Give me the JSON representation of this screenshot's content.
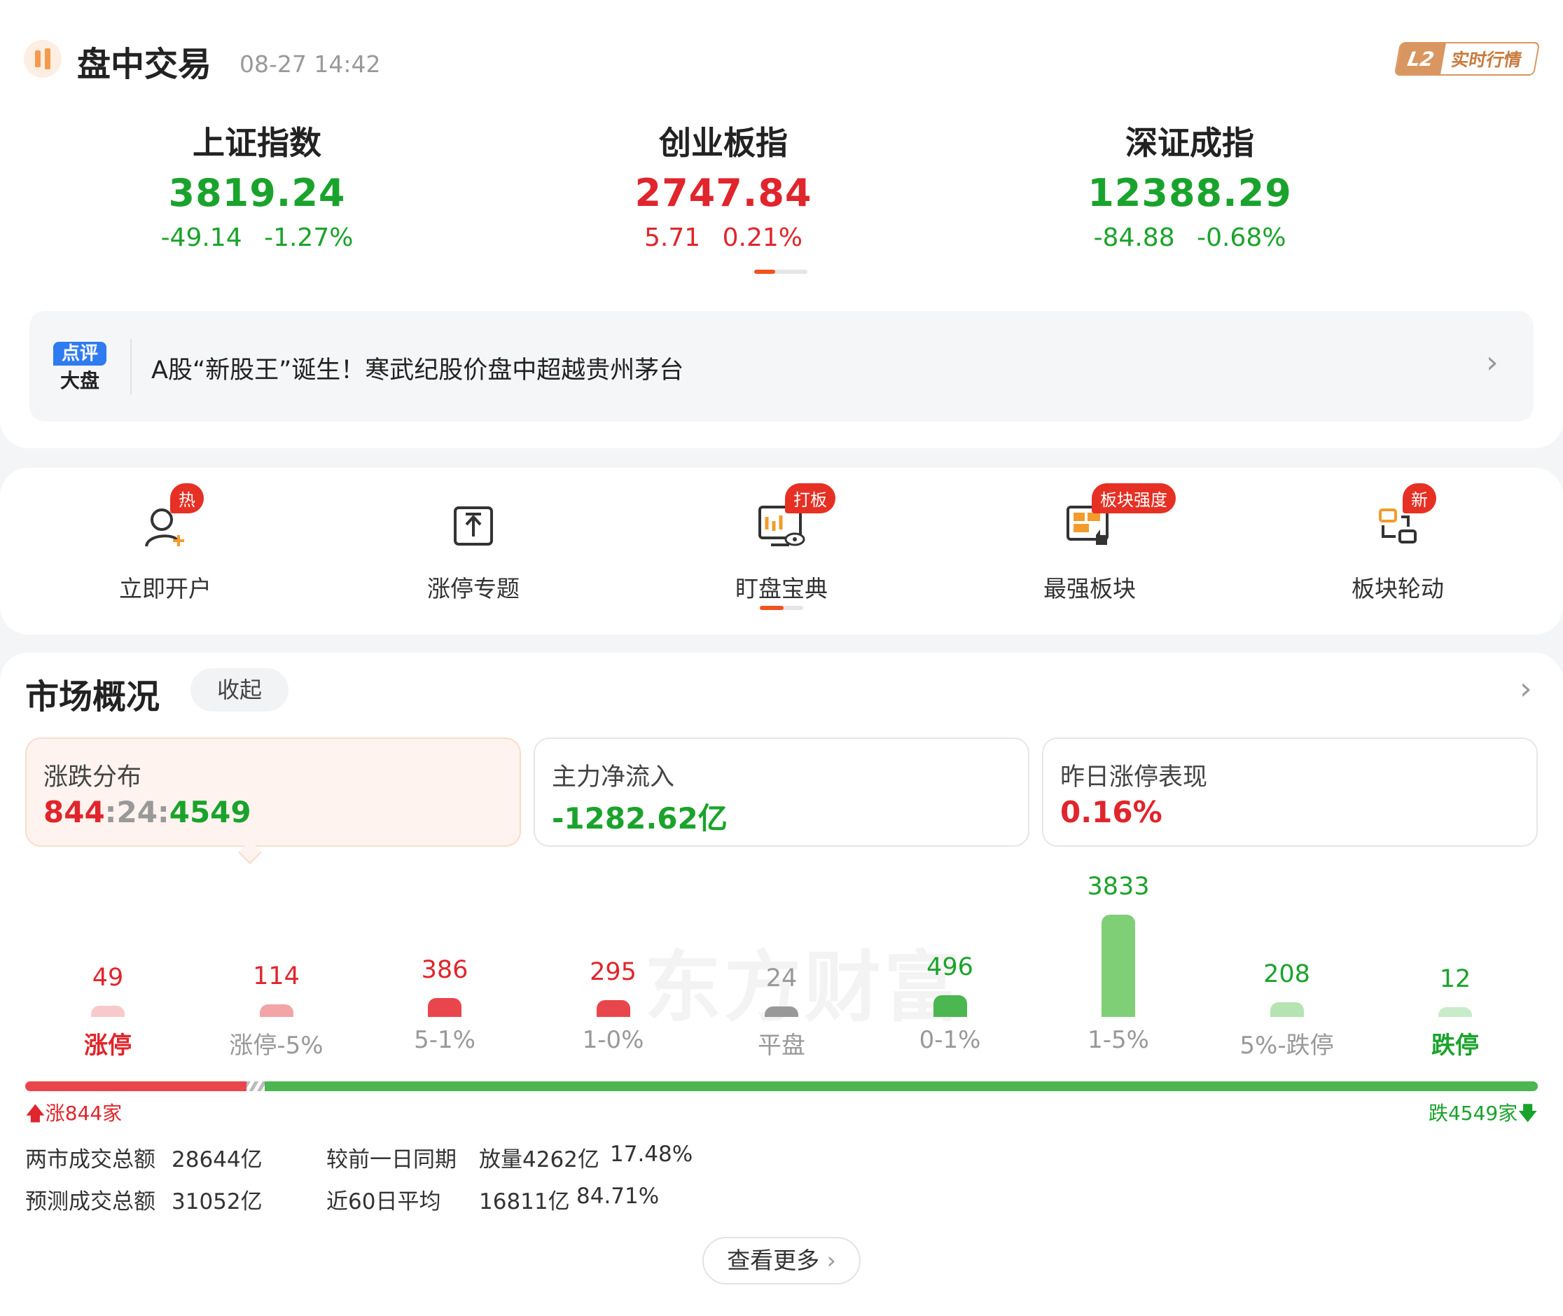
{
  "header": {
    "title": "盘中交易",
    "timestamp": "08-27 14:42",
    "badge_l2": "L2",
    "badge_text": "实时行情"
  },
  "indices": [
    {
      "name": "上证指数",
      "value": "3819.24",
      "change": "-49.14",
      "percent": "-1.27%",
      "trend": "down"
    },
    {
      "name": "创业板指",
      "value": "2747.84",
      "change": "5.71",
      "percent": "0.21%",
      "trend": "up"
    },
    {
      "name": "深证成指",
      "value": "12388.29",
      "change": "-84.88",
      "percent": "-0.68%",
      "trend": "down"
    }
  ],
  "news": {
    "icon_top": "点评",
    "icon_bottom": "大盘",
    "headline": "A股“新股王”诞生！寒武纪股价盘中超越贵州茅台"
  },
  "quick_nav": [
    {
      "label": "立即开户",
      "badge": "热",
      "icon": "user-add-icon"
    },
    {
      "label": "涨停专题",
      "badge": "",
      "icon": "upload-box-icon"
    },
    {
      "label": "盯盘宝典",
      "badge": "打板",
      "icon": "monitor-eye-icon"
    },
    {
      "label": "最强板块",
      "badge": "板块强度",
      "icon": "board-thumb-icon"
    },
    {
      "label": "板块轮动",
      "badge": "新",
      "icon": "rotate-icon"
    }
  ],
  "market": {
    "title": "市场概况",
    "collapse_label": "收起",
    "stats": [
      {
        "title": "涨跌分布",
        "up": "844",
        "flat": "24",
        "down": "4549",
        "sep": ":"
      },
      {
        "title": "主力净流入",
        "value": "-1282.62亿"
      },
      {
        "title": "昨日涨停表现",
        "value": "0.16%"
      }
    ],
    "watermark": "东方财富",
    "distribution": [
      {
        "label": "涨停",
        "count": 49,
        "trend": "up-strong"
      },
      {
        "label": "涨停-5%",
        "count": 114,
        "trend": "up"
      },
      {
        "label": "5-1%",
        "count": 386,
        "trend": "up"
      },
      {
        "label": "1-0%",
        "count": 295,
        "trend": "up"
      },
      {
        "label": "平盘",
        "count": 24,
        "trend": "flat"
      },
      {
        "label": "0-1%",
        "count": 496,
        "trend": "down"
      },
      {
        "label": "1-5%",
        "count": 3833,
        "trend": "down"
      },
      {
        "label": "5%-跌停",
        "count": 208,
        "trend": "down"
      },
      {
        "label": "跌停",
        "count": 12,
        "trend": "down-strong"
      }
    ],
    "ratio": {
      "up_count": 844,
      "down_count": 4549,
      "up_label": "涨844家",
      "down_label": "跌4549家"
    },
    "turnover": [
      {
        "label": "两市成交总额",
        "value": "28644亿",
        "label2": "较前一日同期",
        "value2": "放量4262亿",
        "pct": "17.48%"
      },
      {
        "label": "预测成交总额",
        "value": "31052亿",
        "label2": "近60日平均",
        "value2": "16811亿",
        "pct": "84.71%"
      }
    ],
    "more_label": "查看更多"
  },
  "colors": {
    "up": "#e0252c",
    "down": "#1aa32c",
    "accent": "#f0531e",
    "flat": "#999999"
  }
}
